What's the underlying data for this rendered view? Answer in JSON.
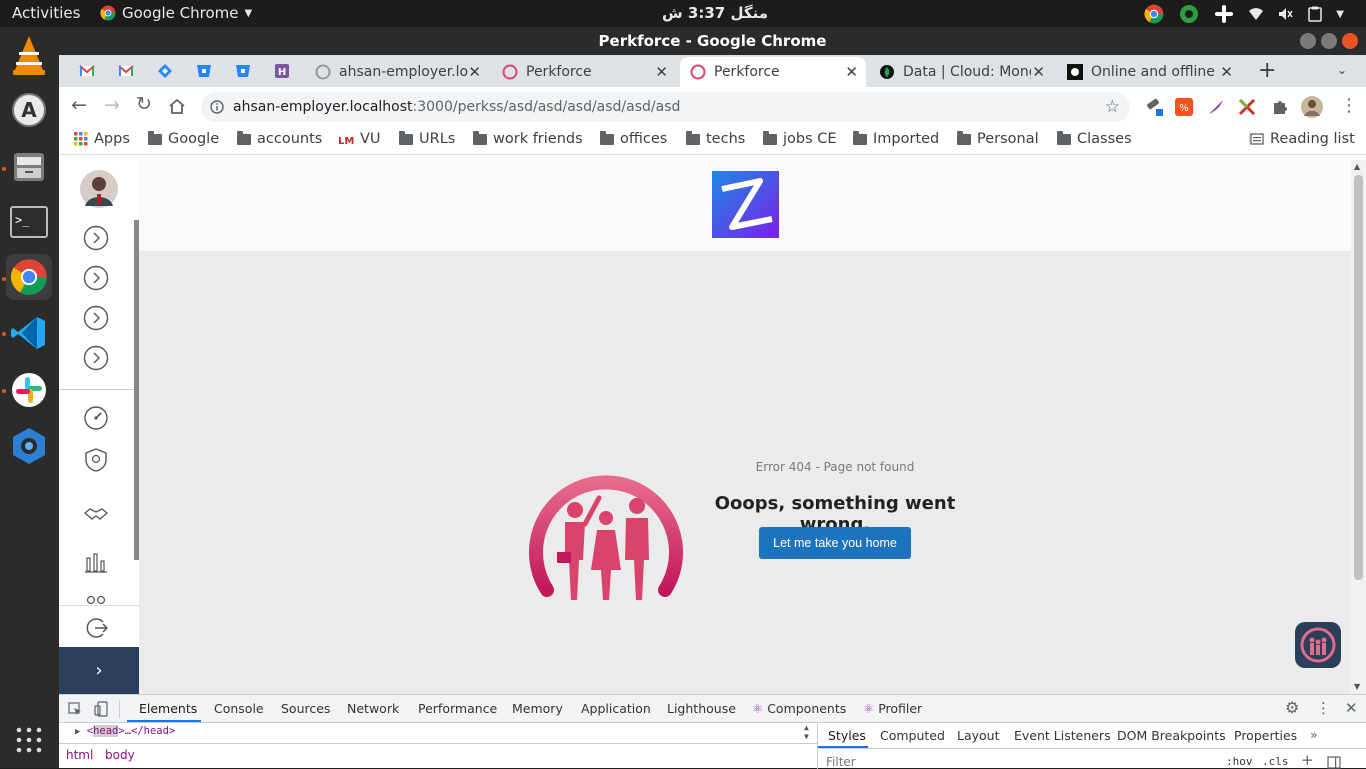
{
  "system": {
    "activities": "Activities",
    "app_name": "Google Chrome",
    "clock": "منگل 3:37 ش"
  },
  "window": {
    "title": "Perkforce - Google Chrome"
  },
  "tabs": [
    {
      "title": "ahsan-employer.lo",
      "active": false
    },
    {
      "title": "Perkforce",
      "active": false
    },
    {
      "title": "Perkforce",
      "active": true
    },
    {
      "title": "Data | Cloud: Mong",
      "active": false
    },
    {
      "title": "Online and offline",
      "active": false
    }
  ],
  "address": {
    "host": "ahsan-employer.localhost",
    "path": ":3000/perkss/asd/asd/asd/asd/asd/asd"
  },
  "bookmarks": {
    "items": [
      "Apps",
      "Google",
      "accounts",
      "VU",
      "URLs",
      "work friends",
      "offices",
      "techs",
      "jobs CE",
      "Imported",
      "Personal",
      "Classes"
    ],
    "reading_list": "Reading list"
  },
  "page": {
    "error_code": "Error 404 - Page not found",
    "error_title": "Ooops, something went wrong.",
    "home_button": "Let me take you home"
  },
  "devtools": {
    "tabs": [
      "Elements",
      "Console",
      "Sources",
      "Network",
      "Performance",
      "Memory",
      "Application",
      "Lighthouse",
      "Components",
      "Profiler"
    ],
    "dom_line_tag": "head",
    "dom_line_rest": "…</head>",
    "breadcrumbs": [
      "html",
      "body"
    ],
    "styles_tabs": [
      "Styles",
      "Computed",
      "Layout",
      "Event Listeners",
      "DOM Breakpoints",
      "Properties"
    ],
    "filter_placeholder": "Filter",
    "hov": ":hov",
    "cls": ".cls"
  },
  "colors": {
    "accent": "#1e73be",
    "sidebar_dark": "#2a3f5a",
    "brand_pink": "#d9436c",
    "logo_purple": "#5a2bd8"
  }
}
